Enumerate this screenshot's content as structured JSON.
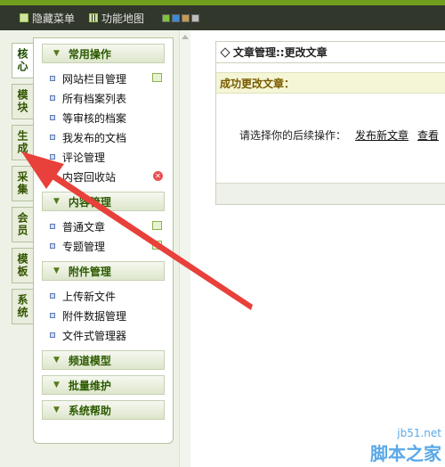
{
  "topbar": {
    "hide_menu": "隐藏菜单",
    "feature_map": "功能地图",
    "skins": [
      "#7fc33a",
      "#3b8ad6",
      "#c79a52",
      "#bdbdbd"
    ]
  },
  "tabs": [
    "核心",
    "模块",
    "生成",
    "采集",
    "会员",
    "模板",
    "系统"
  ],
  "menu": {
    "sec1": {
      "title": "常用操作",
      "items": [
        "网站栏目管理",
        "所有档案列表",
        "等审核的档案",
        "我发布的文档",
        "评论管理",
        "内容回收站"
      ]
    },
    "sec2": {
      "title": "内容管理",
      "items": [
        "普通文章",
        "专题管理"
      ]
    },
    "sec3": {
      "title": "附件管理",
      "items": [
        "上传新文件",
        "附件数据管理",
        "文件式管理器"
      ]
    },
    "sec4": {
      "title": "频道模型"
    },
    "sec5": {
      "title": "批量维护"
    },
    "sec6": {
      "title": "系统帮助"
    }
  },
  "main": {
    "breadcrumb": "文章管理::更改文章",
    "success": "成功更改文章：",
    "prompt": "请选择你的后续操作：",
    "link_publish": "发布新文章",
    "link_view": "查看"
  },
  "watermark": {
    "site": "jb51.net",
    "name": "脚本之家"
  },
  "colors": {
    "accent": "#6f9e1f",
    "arrow": "#e8403a"
  }
}
